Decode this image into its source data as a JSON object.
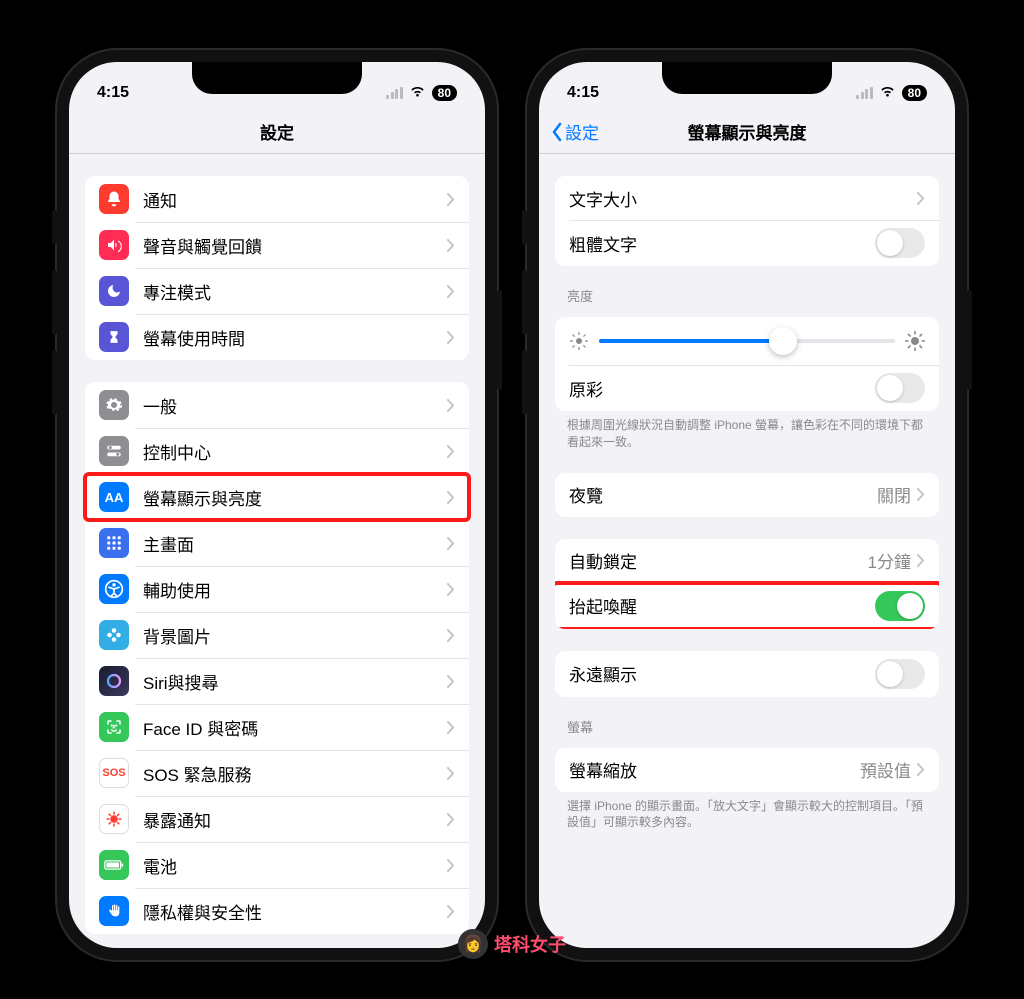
{
  "status": {
    "time": "4:15",
    "battery": "80"
  },
  "left": {
    "title": "設定",
    "groups": [
      [
        {
          "icon": "bell",
          "color": "ic-red",
          "label": "通知"
        },
        {
          "icon": "speaker",
          "color": "ic-pink",
          "label": "聲音與觸覺回饋"
        },
        {
          "icon": "moon",
          "color": "ic-purple",
          "label": "專注模式"
        },
        {
          "icon": "hourglass",
          "color": "ic-purple",
          "label": "螢幕使用時間"
        }
      ],
      [
        {
          "icon": "gear",
          "color": "ic-grey",
          "label": "一般"
        },
        {
          "icon": "switches",
          "color": "ic-grey",
          "label": "控制中心"
        },
        {
          "icon": "AA",
          "color": "ic-blue",
          "label": "螢幕顯示與亮度",
          "highlight": true
        },
        {
          "icon": "grid",
          "color": "ic-homescreen",
          "label": "主畫面"
        },
        {
          "icon": "access",
          "color": "ic-blue",
          "label": "輔助使用"
        },
        {
          "icon": "flower",
          "color": "ic-cyan",
          "label": "背景圖片"
        },
        {
          "icon": "siri",
          "color": "ic-siri",
          "label": "Siri與搜尋"
        },
        {
          "icon": "faceid",
          "color": "ic-green",
          "label": "Face ID 與密碼"
        },
        {
          "icon": "SOS",
          "color": "ic-redw",
          "label": "SOS 緊急服務"
        },
        {
          "icon": "virus",
          "color": "ic-white",
          "label": "暴露通知"
        },
        {
          "icon": "battery",
          "color": "ic-green",
          "label": "電池"
        },
        {
          "icon": "hand",
          "color": "ic-blue",
          "label": "隱私權與安全性"
        }
      ]
    ]
  },
  "right": {
    "back": "設定",
    "title": "螢幕顯示與亮度",
    "text_size": "文字大小",
    "bold_text": "粗體文字",
    "brightness_header": "亮度",
    "brightness_pct": 62,
    "true_tone": "原彩",
    "true_tone_footer": "根據周圍光線狀況自動調整 iPhone 螢幕，讓色彩在不同的環境下都看起來一致。",
    "night_shift": "夜覽",
    "night_shift_value": "關閉",
    "auto_lock": "自動鎖定",
    "auto_lock_value": "1分鐘",
    "raise_to_wake": "抬起喚醒",
    "always_on": "永遠顯示",
    "screen_header": "螢幕",
    "zoom": "螢幕縮放",
    "zoom_value": "預設值",
    "zoom_footer": "選擇 iPhone 的顯示畫面。「放大文字」會顯示較大的控制項目。「預設值」可顯示較多內容。"
  },
  "watermark": "塔科女子"
}
